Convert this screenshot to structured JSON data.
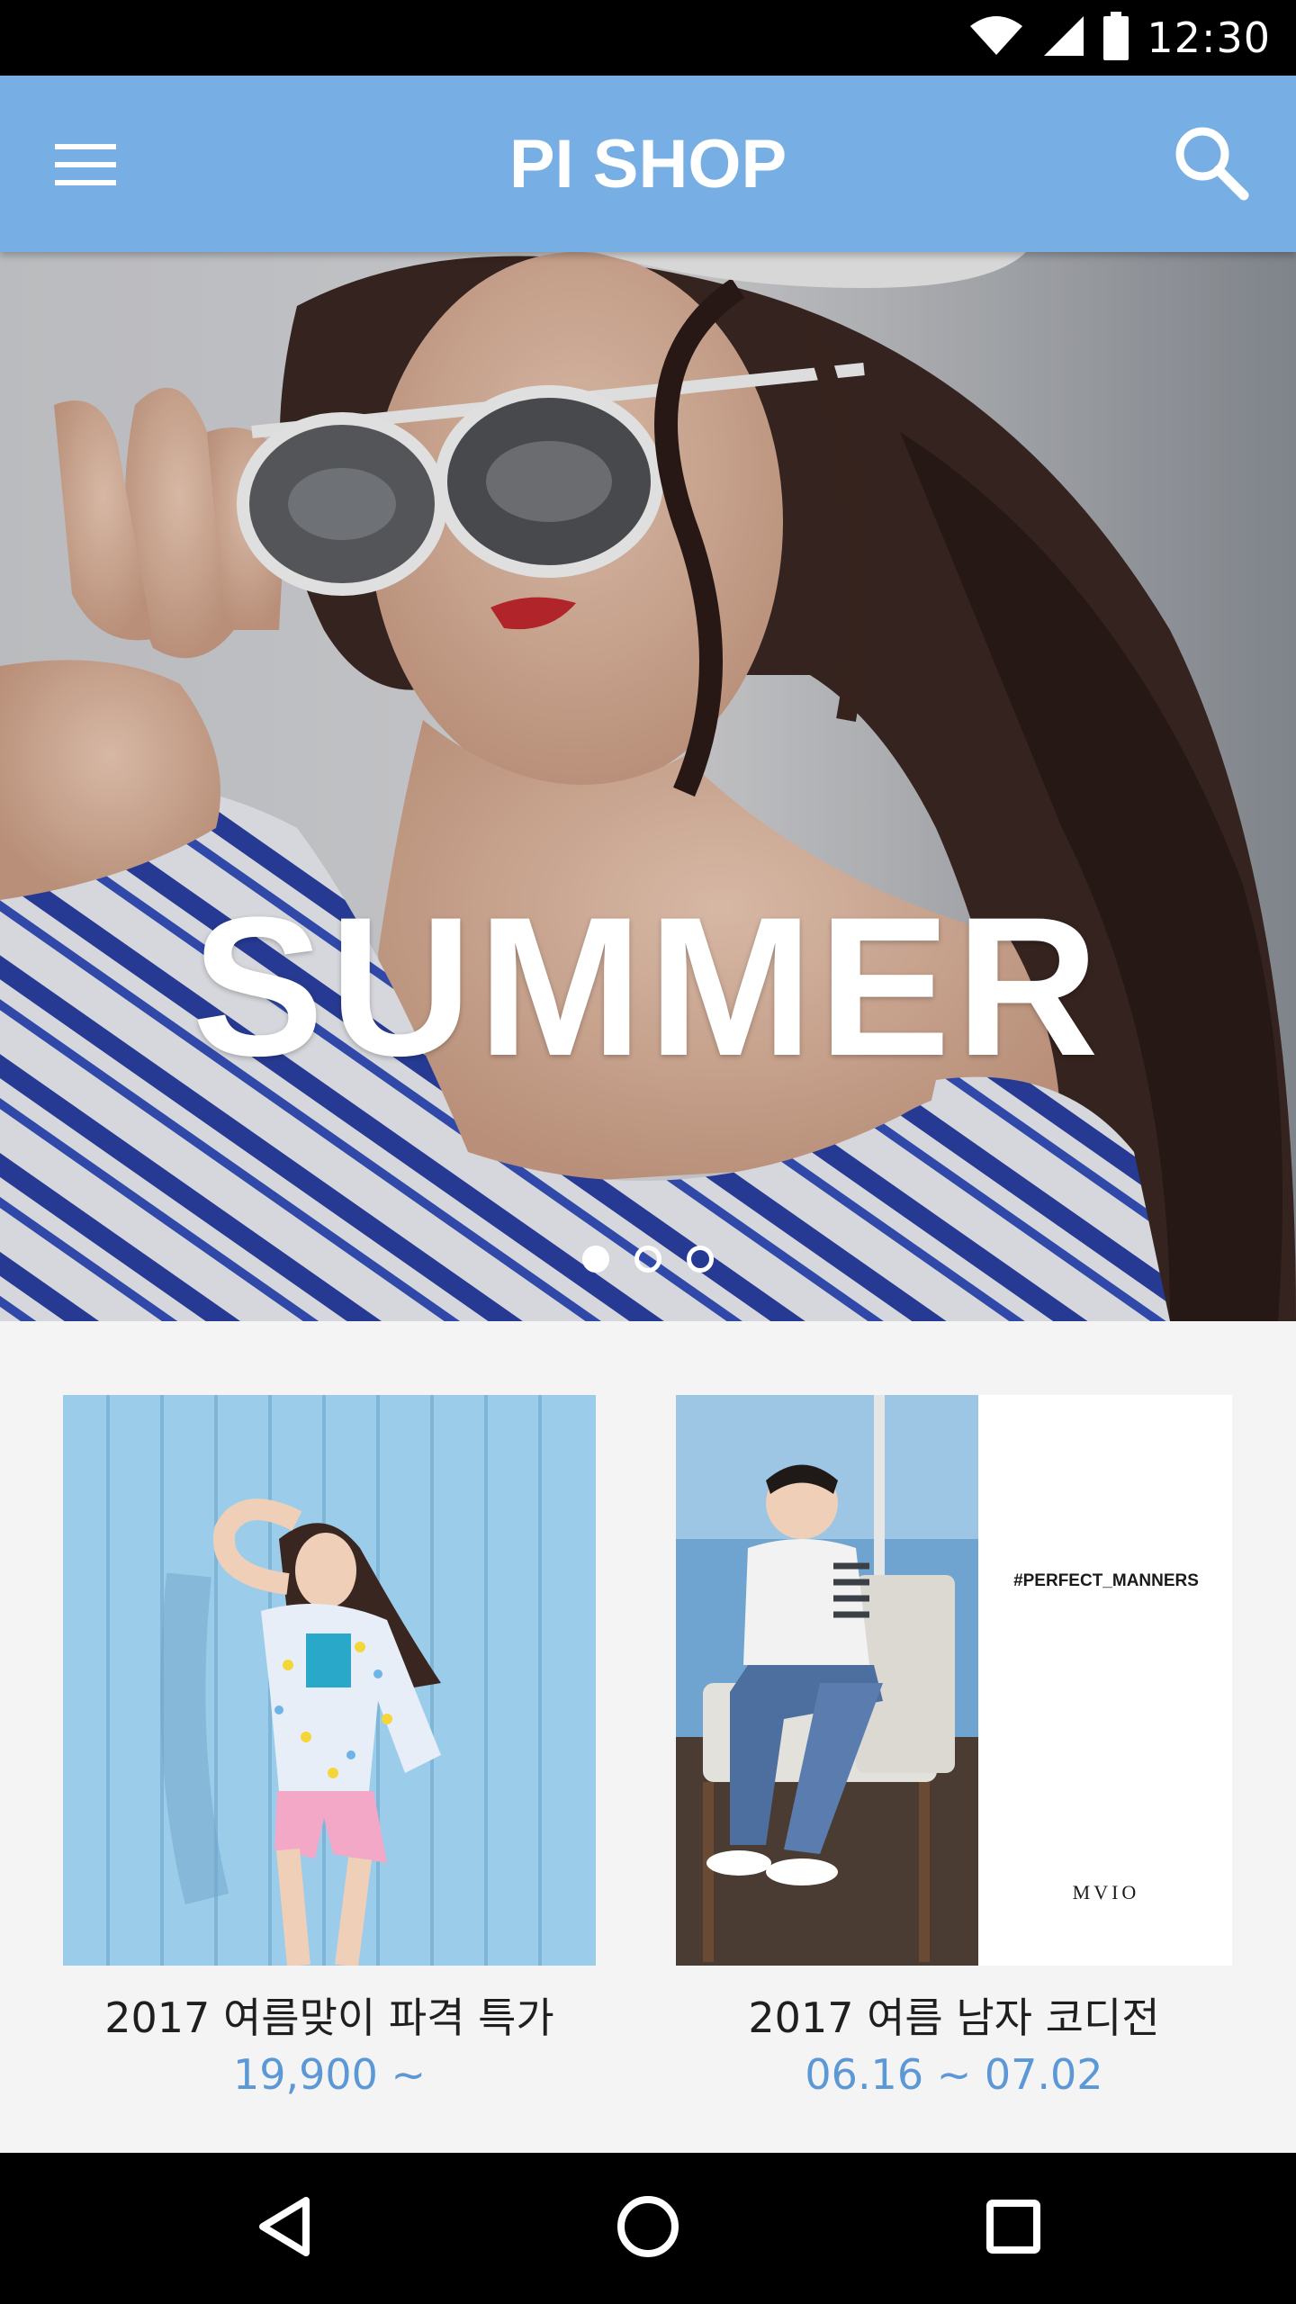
{
  "status_bar": {
    "time": "12:30",
    "icons": [
      "wifi-icon",
      "signal-icon",
      "battery-icon"
    ]
  },
  "app_bar": {
    "title": "PI SHOP",
    "menu_icon": "hamburger-menu-icon",
    "search_icon": "search-icon",
    "color": "#77aee3"
  },
  "hero": {
    "title": "SUMMER",
    "slide_count": 3,
    "active_slide": 1
  },
  "cards": [
    {
      "title": "2017 여름맞이 파격 특가",
      "subtitle": "19,900 ~"
    },
    {
      "title": "2017 여름 남자 코디전",
      "subtitle": "06.16 ~ 07.02",
      "poster_tag": "#PERFECT_MANNERS",
      "poster_brand": "MVIO"
    }
  ],
  "accent_color": "#5c98d6",
  "nav_bar": {
    "icons": [
      "back-icon",
      "home-icon",
      "recents-icon"
    ]
  }
}
